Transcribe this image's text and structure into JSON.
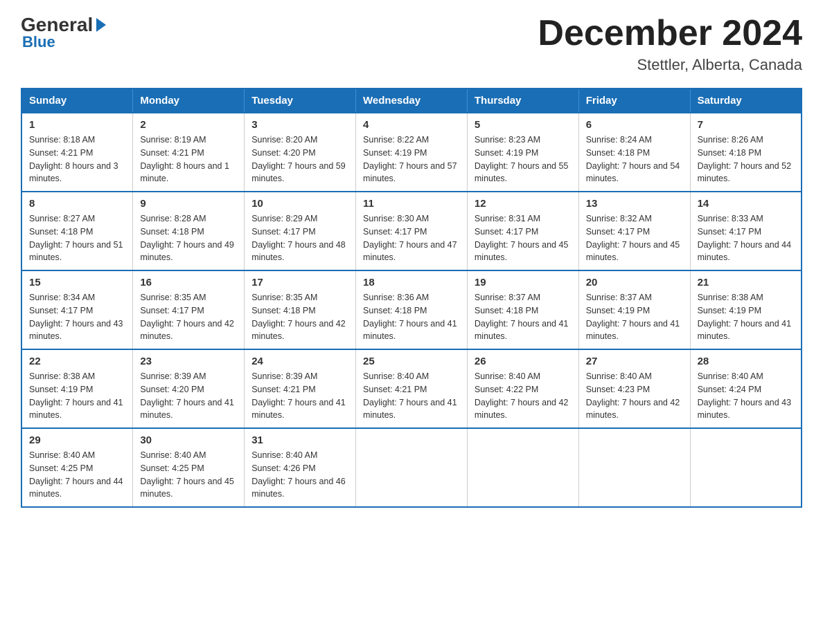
{
  "header": {
    "logo_text_general": "General",
    "logo_text_blue": "Blue",
    "month_title": "December 2024",
    "location": "Stettler, Alberta, Canada"
  },
  "days_of_week": [
    "Sunday",
    "Monday",
    "Tuesday",
    "Wednesday",
    "Thursday",
    "Friday",
    "Saturday"
  ],
  "weeks": [
    [
      {
        "num": "1",
        "sunrise": "8:18 AM",
        "sunset": "4:21 PM",
        "daylight": "8 hours and 3 minutes."
      },
      {
        "num": "2",
        "sunrise": "8:19 AM",
        "sunset": "4:21 PM",
        "daylight": "8 hours and 1 minute."
      },
      {
        "num": "3",
        "sunrise": "8:20 AM",
        "sunset": "4:20 PM",
        "daylight": "7 hours and 59 minutes."
      },
      {
        "num": "4",
        "sunrise": "8:22 AM",
        "sunset": "4:19 PM",
        "daylight": "7 hours and 57 minutes."
      },
      {
        "num": "5",
        "sunrise": "8:23 AM",
        "sunset": "4:19 PM",
        "daylight": "7 hours and 55 minutes."
      },
      {
        "num": "6",
        "sunrise": "8:24 AM",
        "sunset": "4:18 PM",
        "daylight": "7 hours and 54 minutes."
      },
      {
        "num": "7",
        "sunrise": "8:26 AM",
        "sunset": "4:18 PM",
        "daylight": "7 hours and 52 minutes."
      }
    ],
    [
      {
        "num": "8",
        "sunrise": "8:27 AM",
        "sunset": "4:18 PM",
        "daylight": "7 hours and 51 minutes."
      },
      {
        "num": "9",
        "sunrise": "8:28 AM",
        "sunset": "4:18 PM",
        "daylight": "7 hours and 49 minutes."
      },
      {
        "num": "10",
        "sunrise": "8:29 AM",
        "sunset": "4:17 PM",
        "daylight": "7 hours and 48 minutes."
      },
      {
        "num": "11",
        "sunrise": "8:30 AM",
        "sunset": "4:17 PM",
        "daylight": "7 hours and 47 minutes."
      },
      {
        "num": "12",
        "sunrise": "8:31 AM",
        "sunset": "4:17 PM",
        "daylight": "7 hours and 45 minutes."
      },
      {
        "num": "13",
        "sunrise": "8:32 AM",
        "sunset": "4:17 PM",
        "daylight": "7 hours and 45 minutes."
      },
      {
        "num": "14",
        "sunrise": "8:33 AM",
        "sunset": "4:17 PM",
        "daylight": "7 hours and 44 minutes."
      }
    ],
    [
      {
        "num": "15",
        "sunrise": "8:34 AM",
        "sunset": "4:17 PM",
        "daylight": "7 hours and 43 minutes."
      },
      {
        "num": "16",
        "sunrise": "8:35 AM",
        "sunset": "4:17 PM",
        "daylight": "7 hours and 42 minutes."
      },
      {
        "num": "17",
        "sunrise": "8:35 AM",
        "sunset": "4:18 PM",
        "daylight": "7 hours and 42 minutes."
      },
      {
        "num": "18",
        "sunrise": "8:36 AM",
        "sunset": "4:18 PM",
        "daylight": "7 hours and 41 minutes."
      },
      {
        "num": "19",
        "sunrise": "8:37 AM",
        "sunset": "4:18 PM",
        "daylight": "7 hours and 41 minutes."
      },
      {
        "num": "20",
        "sunrise": "8:37 AM",
        "sunset": "4:19 PM",
        "daylight": "7 hours and 41 minutes."
      },
      {
        "num": "21",
        "sunrise": "8:38 AM",
        "sunset": "4:19 PM",
        "daylight": "7 hours and 41 minutes."
      }
    ],
    [
      {
        "num": "22",
        "sunrise": "8:38 AM",
        "sunset": "4:19 PM",
        "daylight": "7 hours and 41 minutes."
      },
      {
        "num": "23",
        "sunrise": "8:39 AM",
        "sunset": "4:20 PM",
        "daylight": "7 hours and 41 minutes."
      },
      {
        "num": "24",
        "sunrise": "8:39 AM",
        "sunset": "4:21 PM",
        "daylight": "7 hours and 41 minutes."
      },
      {
        "num": "25",
        "sunrise": "8:40 AM",
        "sunset": "4:21 PM",
        "daylight": "7 hours and 41 minutes."
      },
      {
        "num": "26",
        "sunrise": "8:40 AM",
        "sunset": "4:22 PM",
        "daylight": "7 hours and 42 minutes."
      },
      {
        "num": "27",
        "sunrise": "8:40 AM",
        "sunset": "4:23 PM",
        "daylight": "7 hours and 42 minutes."
      },
      {
        "num": "28",
        "sunrise": "8:40 AM",
        "sunset": "4:24 PM",
        "daylight": "7 hours and 43 minutes."
      }
    ],
    [
      {
        "num": "29",
        "sunrise": "8:40 AM",
        "sunset": "4:25 PM",
        "daylight": "7 hours and 44 minutes."
      },
      {
        "num": "30",
        "sunrise": "8:40 AM",
        "sunset": "4:25 PM",
        "daylight": "7 hours and 45 minutes."
      },
      {
        "num": "31",
        "sunrise": "8:40 AM",
        "sunset": "4:26 PM",
        "daylight": "7 hours and 46 minutes."
      },
      {
        "num": "",
        "sunrise": "",
        "sunset": "",
        "daylight": ""
      },
      {
        "num": "",
        "sunrise": "",
        "sunset": "",
        "daylight": ""
      },
      {
        "num": "",
        "sunrise": "",
        "sunset": "",
        "daylight": ""
      },
      {
        "num": "",
        "sunrise": "",
        "sunset": "",
        "daylight": ""
      }
    ]
  ]
}
